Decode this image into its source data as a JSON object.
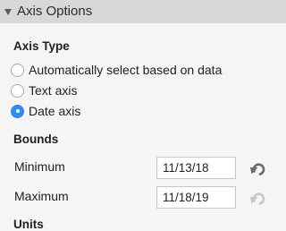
{
  "panel": {
    "header_title": "Axis Options"
  },
  "axis_type": {
    "title": "Axis Type",
    "options": [
      {
        "label": "Automatically select based on data",
        "selected": false
      },
      {
        "label": "Text axis",
        "selected": false
      },
      {
        "label": "Date axis",
        "selected": true
      }
    ]
  },
  "bounds": {
    "title": "Bounds",
    "minimum": {
      "label": "Minimum",
      "value": "11/13/18",
      "reset_enabled": true
    },
    "maximum": {
      "label": "Maximum",
      "value": "11/18/19",
      "reset_enabled": false
    }
  },
  "next_section": {
    "title": "Units"
  },
  "colors": {
    "accent": "#2f8df5",
    "header_bg": "#d8d8d8",
    "panel_bg": "#f5f5f5",
    "reset_enabled": "#6b6b6b",
    "reset_disabled": "#c8c8c8"
  },
  "icons": {
    "collapse": "triangle-down",
    "reset": "undo-arrow"
  }
}
